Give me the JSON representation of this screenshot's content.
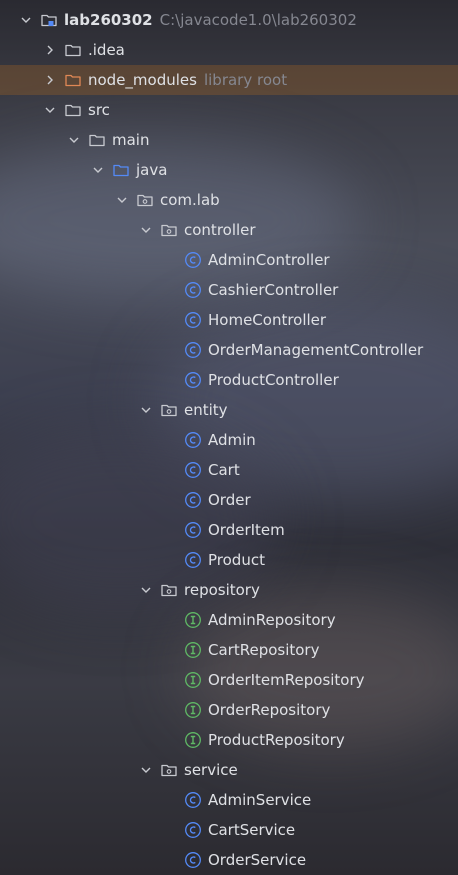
{
  "project": {
    "name": "lab260302",
    "path": "C:\\javacode1.0\\lab260302"
  },
  "tree": {
    "idea": ".idea",
    "node_modules": "node_modules",
    "node_modules_hint": "library root",
    "src": "src",
    "main": "main",
    "java": "java",
    "package": "com.lab",
    "controller": {
      "name": "controller",
      "files": [
        "AdminController",
        "CashierController",
        "HomeController",
        "OrderManagementController",
        "ProductController"
      ]
    },
    "entity": {
      "name": "entity",
      "files": [
        "Admin",
        "Cart",
        "Order",
        "OrderItem",
        "Product"
      ]
    },
    "repository": {
      "name": "repository",
      "files": [
        "AdminRepository",
        "CartRepository",
        "OrderItemRepository",
        "OrderRepository",
        "ProductRepository"
      ]
    },
    "service": {
      "name": "service",
      "files": [
        "AdminService",
        "CartService",
        "OrderService"
      ]
    }
  },
  "colors": {
    "class_icon": "#548af7",
    "interface_icon": "#5fb865",
    "excluded_folder": "#e08855",
    "source_folder": "#548af7"
  },
  "icons": {
    "expanded": "chevron-down-icon",
    "collapsed": "chevron-right-icon",
    "module": "module-icon",
    "folder": "folder-icon",
    "package": "package-icon",
    "class": "class-icon",
    "interface": "interface-icon"
  }
}
